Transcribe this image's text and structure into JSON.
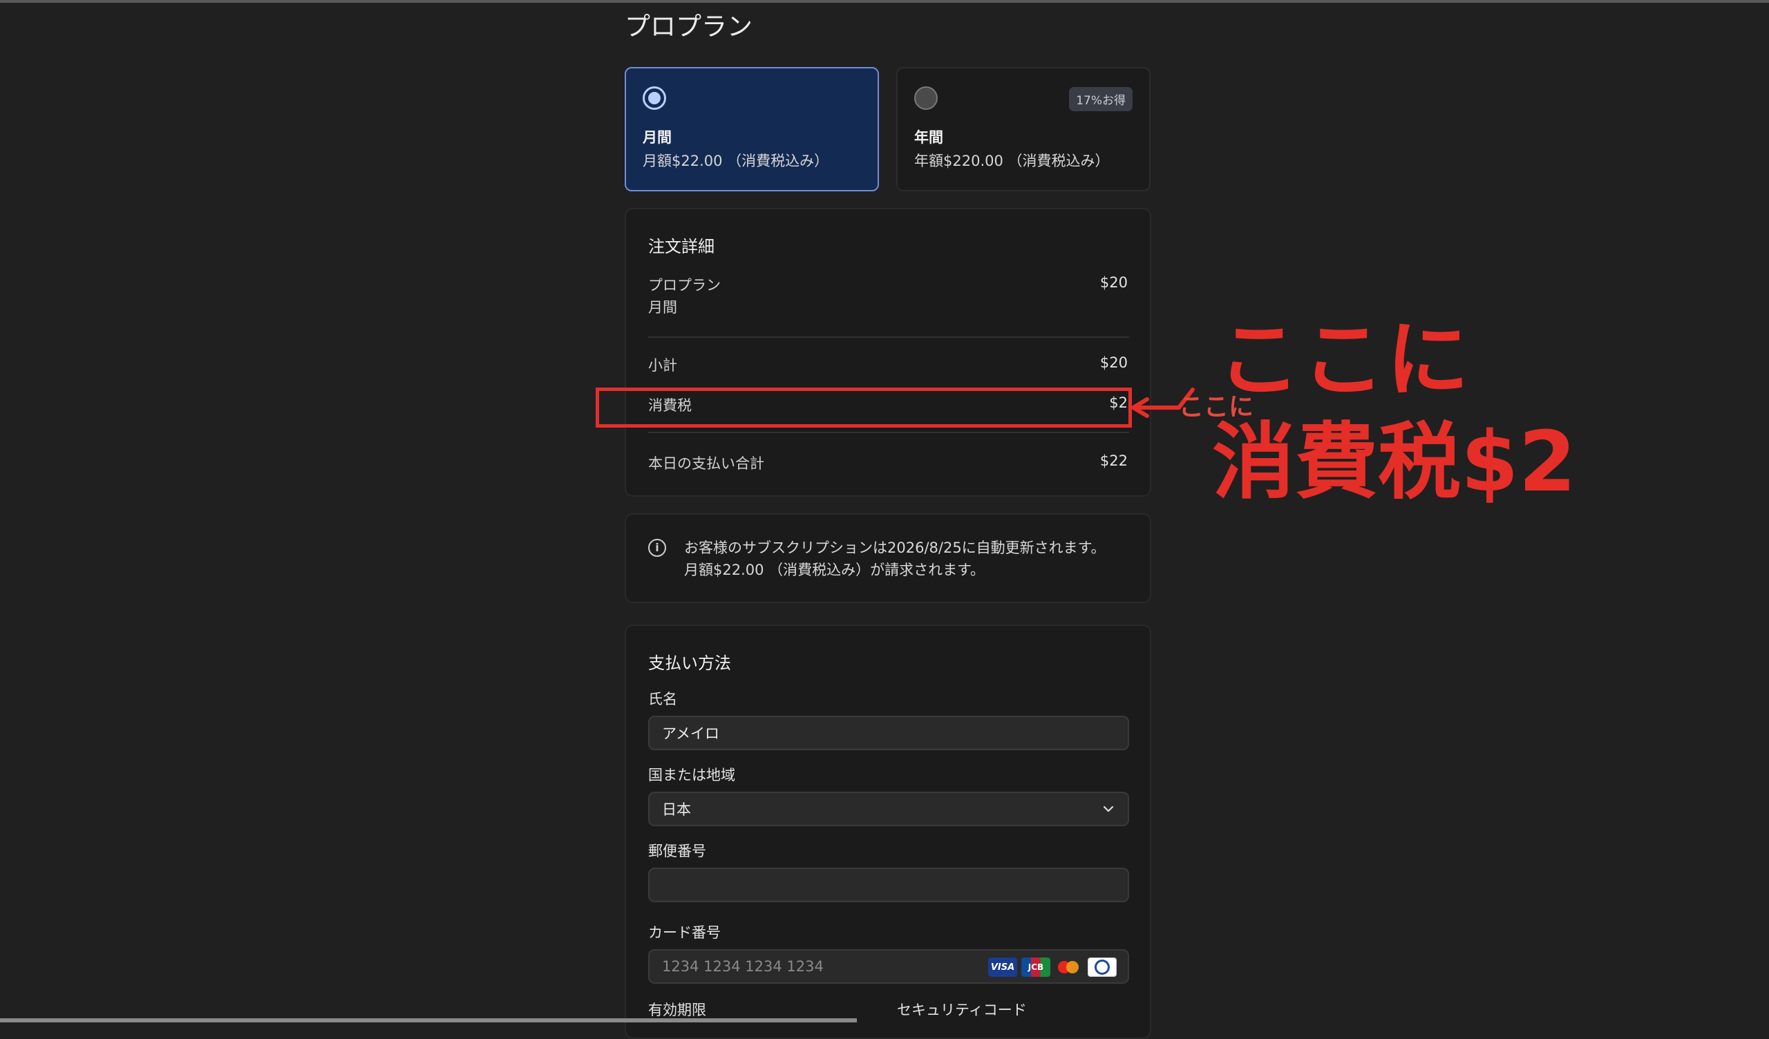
{
  "page_title": "プロプラン",
  "plans": [
    {
      "name": "月間",
      "price": "月額$22.00 （消費税込み）",
      "selected": true
    },
    {
      "name": "年間",
      "price": "年額$220.00 （消費税込み）",
      "selected": false,
      "badge": "17%お得"
    }
  ],
  "order": {
    "title": "注文詳細",
    "item_name": "プロプラン",
    "item_period": "月間",
    "item_price": "$20",
    "subtotal_label": "小計",
    "subtotal_value": "$20",
    "tax_label": "消費税",
    "tax_value": "$2",
    "total_label": "本日の支払い合計",
    "total_value": "$22"
  },
  "notice": {
    "line1": "お客様のサブスクリプションは2026/8/25に自動更新されます。",
    "line2": "月額$22.00 （消費税込み）が請求されます。"
  },
  "payment": {
    "title": "支払い方法",
    "name_label": "氏名",
    "name_value": "アメイロ",
    "country_label": "国または地域",
    "country_value": "日本",
    "postal_label": "郵便番号",
    "postal_value": "",
    "card_label": "カード番号",
    "card_placeholder": "1234 1234 1234 1234",
    "card_brands": [
      "VISA",
      "JCB",
      "Mastercard",
      "Diners Club"
    ],
    "expiry_label": "有効期限",
    "cvc_label": "セキュリティコード"
  },
  "annotation": {
    "small_text": "ここに",
    "big_line1": "ここに",
    "big_line2": "消費税$2",
    "color": "#e52e28"
  }
}
